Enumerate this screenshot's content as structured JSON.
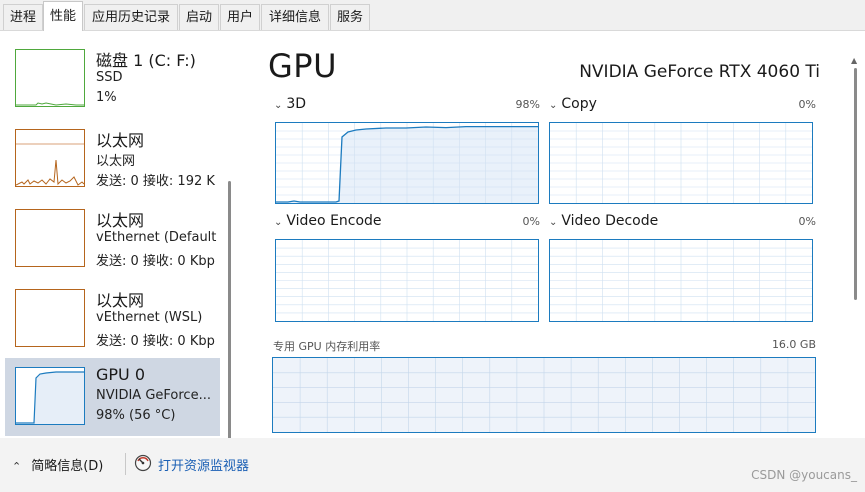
{
  "tabs": [
    {
      "label": "进程",
      "active": false
    },
    {
      "label": "性能",
      "active": true
    },
    {
      "label": "应用历史记录",
      "active": false
    },
    {
      "label": "启动",
      "active": false
    },
    {
      "label": "用户",
      "active": false
    },
    {
      "label": "详细信息",
      "active": false
    },
    {
      "label": "服务",
      "active": false
    }
  ],
  "left_items": [
    {
      "title": "磁盘 1 (C: F:)",
      "sub1": "SSD",
      "sub2": "1%",
      "color": "#4fa83d",
      "selected": false
    },
    {
      "title": "以太网",
      "sub1": "以太网",
      "sub2": "发送: 0 接收: 192 K",
      "color": "#b5651d",
      "selected": false
    },
    {
      "title": "以太网",
      "sub1": "vEthernet (Default ...",
      "sub2": "发送: 0 接收: 0 Kbp",
      "color": "#b5651d",
      "selected": false
    },
    {
      "title": "以太网",
      "sub1": "vEthernet (WSL)",
      "sub2": "发送: 0 接收: 0 Kbp",
      "color": "#b5651d",
      "selected": false
    },
    {
      "title": "GPU 0",
      "sub1": "NVIDIA GeForce...",
      "sub2": "98% (56 °C)",
      "color": "#1c7bbf",
      "selected": true
    }
  ],
  "main": {
    "title": "GPU",
    "model": "NVIDIA GeForce RTX 4060 Ti",
    "engines": [
      {
        "name": "3D",
        "percent": "98%",
        "current_utilization": 0.98
      },
      {
        "name": "Copy",
        "percent": "0%",
        "current_utilization": 0
      },
      {
        "name": "Video Encode",
        "percent": "0%",
        "current_utilization": 0
      },
      {
        "name": "Video Decode",
        "percent": "0%",
        "current_utilization": 0
      }
    ],
    "memory_label": "专用 GPU 内存利用率",
    "memory_total": "16.0 GB"
  },
  "bottom": {
    "summary": "简略信息(D)",
    "monitor_link": "打开资源监视器"
  },
  "watermark": "CSDN @youcans_",
  "colors": {
    "gpu": "#1c7bbf",
    "network": "#b5651d",
    "disk": "#4fa83d",
    "selected": "#cfd7e3"
  }
}
